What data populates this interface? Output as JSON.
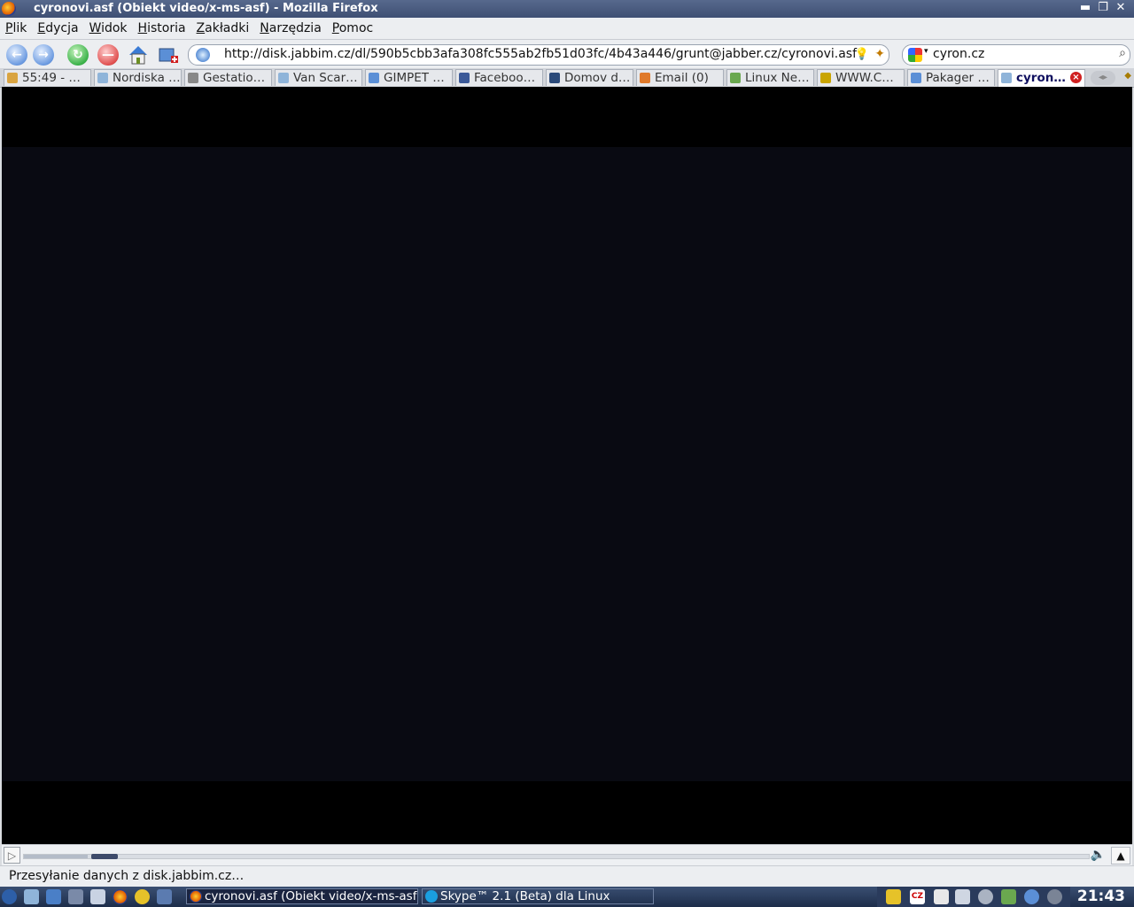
{
  "window": {
    "title": "cyronovi.asf (Obiekt video/x-ms-asf) - Mozilla Firefox",
    "minimize": "▬",
    "maximize": "❐",
    "close": "✕"
  },
  "menu": [
    {
      "label": "Plik"
    },
    {
      "label": "Edycja"
    },
    {
      "label": "Widok"
    },
    {
      "label": "Historia"
    },
    {
      "label": "Zakładki"
    },
    {
      "label": "Narzędzia"
    },
    {
      "label": "Pomoc"
    }
  ],
  "nav": {
    "url": "http://disk.jabbim.cz/dl/590b5cbb3afa308fc555ab2fb51d03fc/4b43a446/grunt@jabber.cz/cyronovi.asf",
    "search_term": "cyron.cz",
    "back_glyph": "←",
    "forward_glyph": "→",
    "reload_glyph": "↻",
    "stop_glyph": "—"
  },
  "tabs": [
    {
      "label": "55:49 - …",
      "icon": "clock-icon",
      "color": "#d9a441"
    },
    {
      "label": "Nordiska …",
      "icon": "globe-icon",
      "color": "#8fb4d9"
    },
    {
      "label": "Gestatio…",
      "icon": "bird-icon",
      "color": "#888888"
    },
    {
      "label": "Van Scar…",
      "icon": "globe-icon",
      "color": "#8fb4d9"
    },
    {
      "label": "GIMPET …",
      "icon": "paw-icon",
      "color": "#5b8fd6"
    },
    {
      "label": "Faceboo…",
      "icon": "facebook-icon",
      "color": "#3b5998"
    },
    {
      "label": "Domov d…",
      "icon": "site-icon",
      "color": "#2b4a7a"
    },
    {
      "label": "Email (0)",
      "icon": "email-icon",
      "color": "#e07a2b"
    },
    {
      "label": "Linux Ne…",
      "icon": "linux-icon",
      "color": "#6aa84f"
    },
    {
      "label": "WWW.C…",
      "icon": "star-icon",
      "color": "#c9a400"
    },
    {
      "label": "Pakager …",
      "icon": "package-icon",
      "color": "#5b8fd6"
    },
    {
      "label": "cyron…",
      "icon": "globe-icon",
      "color": "#8fb4d9",
      "active": true
    }
  ],
  "player": {
    "play_glyph": "▷",
    "volume_glyph": "🔈",
    "fullscreen_glyph": "▲",
    "buffered": 0.06,
    "position": 0.06
  },
  "status": {
    "message": "Przesyłanie danych z disk.jabbim.cz…"
  },
  "taskbar": {
    "tasks": [
      {
        "label": "cyronovi.asf (Obiekt video/x-ms-asf)",
        "icon": "firefox-icon",
        "active": true
      },
      {
        "label": "Skype™ 2.1 (Beta) dla Linux",
        "icon": "skype-icon",
        "active": false
      }
    ],
    "layout_badge": "CZ",
    "clock": "21:43"
  }
}
